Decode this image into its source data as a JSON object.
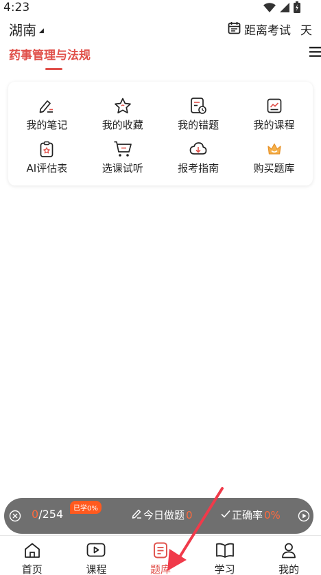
{
  "status_bar": {
    "time": "4:23"
  },
  "header": {
    "region": "湖南",
    "exam_countdown_label": "距离考试",
    "exam_days_suffix": "天"
  },
  "subject": {
    "title": "药事管理与法规"
  },
  "quick_grid": [
    {
      "label": "我的笔记",
      "icon": "pencil-note-icon"
    },
    {
      "label": "我的收藏",
      "icon": "star-icon"
    },
    {
      "label": "我的错题",
      "icon": "wrong-questions-icon"
    },
    {
      "label": "我的课程",
      "icon": "course-icon"
    },
    {
      "label": "AI评估表",
      "icon": "clipboard-icon"
    },
    {
      "label": "选课试听",
      "icon": "cart-icon"
    },
    {
      "label": "报考指南",
      "icon": "cloud-download-icon"
    },
    {
      "label": "购买题库",
      "icon": "crown-icon"
    }
  ],
  "progress": {
    "current": "0",
    "total": "/254",
    "learned_badge": "已学0%",
    "today_label": "今日做题",
    "today_value": "0",
    "accuracy_label": "正确率",
    "accuracy_value": "0%"
  },
  "bottom_nav": [
    {
      "label": "首页",
      "icon": "home-icon",
      "active": false
    },
    {
      "label": "课程",
      "icon": "play-icon",
      "active": false
    },
    {
      "label": "题库",
      "icon": "question-bank-icon",
      "active": true
    },
    {
      "label": "学习",
      "icon": "book-icon",
      "active": false
    },
    {
      "label": "我的",
      "icon": "profile-icon",
      "active": false
    }
  ],
  "colors": {
    "accent": "#e0504a",
    "highlight": "#ff6a3d",
    "pill_bg": "#6f6f6f"
  }
}
